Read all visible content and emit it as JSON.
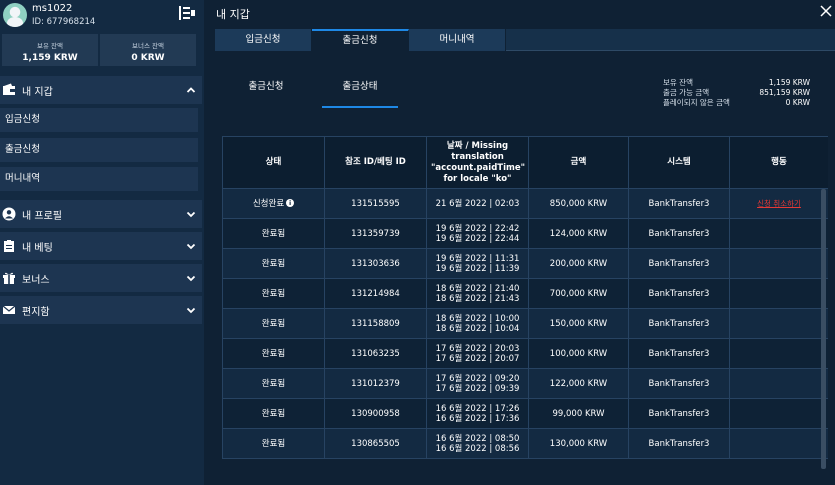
{
  "user": {
    "name": "ms1022",
    "id": "ID: 677968214"
  },
  "balances": [
    {
      "label": "보유 잔액",
      "value": "1,159 KRW"
    },
    {
      "label": "보너스 잔액",
      "value": "0 KRW"
    }
  ],
  "sidebar": {
    "wallet_section": "내 지갑",
    "sub_items": [
      "입금신청",
      "출금신청",
      "머니내역"
    ],
    "sections": [
      "내 프로필",
      "내 베팅",
      "보너스",
      "편지함"
    ]
  },
  "main": {
    "title": "내 지갑",
    "tabs": [
      "입금신청",
      "출금신청",
      "머니내역"
    ],
    "active_tab": "출금신청",
    "subtabs": [
      "출금신청",
      "출금상태"
    ],
    "active_subtab": "출금상태",
    "summary": {
      "labels": [
        "보유 잔액",
        "출금 가능 금액",
        "플레이되지 않은 금액"
      ],
      "values": [
        "1,159 KRW",
        "851,159 KRW",
        "0 KRW"
      ]
    },
    "table": {
      "headers": [
        "상태",
        "참조 ID/베팅 ID",
        "날짜 / Missing translation \"account.paidTime\" for locale \"ko\"",
        "금액",
        "시스템",
        "행동"
      ],
      "rows": [
        {
          "status": "신청완료",
          "ref": "131515595",
          "date1": "21 6월 2022 | 02:03",
          "date2": "",
          "amount": "850,000 KRW",
          "system": "BankTransfer3",
          "action": "신청 취소하기"
        },
        {
          "status": "완료됨",
          "ref": "131359739",
          "date1": "19 6월 2022 | 22:42",
          "date2": "19 6월 2022 | 22:44",
          "amount": "124,000 KRW",
          "system": "BankTransfer3",
          "action": ""
        },
        {
          "status": "완료됨",
          "ref": "131303636",
          "date1": "19 6월 2022 | 11:31",
          "date2": "19 6월 2022 | 11:39",
          "amount": "200,000 KRW",
          "system": "BankTransfer3",
          "action": ""
        },
        {
          "status": "완료됨",
          "ref": "131214984",
          "date1": "18 6월 2022 | 21:40",
          "date2": "18 6월 2022 | 21:43",
          "amount": "700,000 KRW",
          "system": "BankTransfer3",
          "action": ""
        },
        {
          "status": "완료됨",
          "ref": "131158809",
          "date1": "18 6월 2022 | 10:00",
          "date2": "18 6월 2022 | 10:04",
          "amount": "150,000 KRW",
          "system": "BankTransfer3",
          "action": ""
        },
        {
          "status": "완료됨",
          "ref": "131063235",
          "date1": "17 6월 2022 | 20:03",
          "date2": "17 6월 2022 | 20:07",
          "amount": "100,000 KRW",
          "system": "BankTransfer3",
          "action": ""
        },
        {
          "status": "완료됨",
          "ref": "131012379",
          "date1": "17 6월 2022 | 09:20",
          "date2": "17 6월 2022 | 09:39",
          "amount": "122,000 KRW",
          "system": "BankTransfer3",
          "action": ""
        },
        {
          "status": "완료됨",
          "ref": "130900958",
          "date1": "16 6월 2022 | 17:26",
          "date2": "16 6월 2022 | 17:36",
          "amount": "99,000 KRW",
          "system": "BankTransfer3",
          "action": ""
        },
        {
          "status": "완료됨",
          "ref": "130865505",
          "date1": "16 6월 2022 | 08:50",
          "date2": "16 6월 2022 | 08:56",
          "amount": "130,000 KRW",
          "system": "BankTransfer3",
          "action": ""
        }
      ]
    }
  },
  "colors": {
    "accent": "#1e88e5",
    "danger": "#e53935",
    "bg": "#0f2134",
    "sidebar": "#132a42"
  }
}
